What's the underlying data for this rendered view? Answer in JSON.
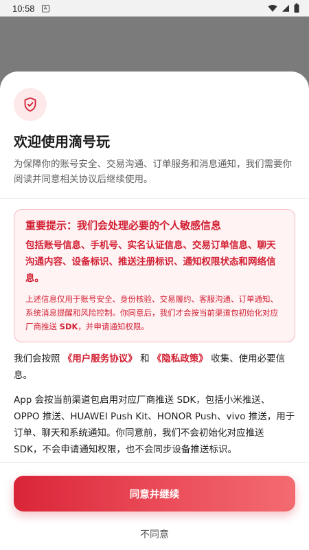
{
  "status_bar": {
    "time": "10:58",
    "notification_icon": "a-badge-icon",
    "icons": [
      "wifi-icon",
      "signal-icon",
      "battery-icon"
    ]
  },
  "dialog": {
    "icon": "shield-check-icon",
    "title": "欢迎使用滴号玩",
    "subtitle": "为保障你的账号安全、交易沟通、订单服务和消息通知，我们需要你阅读并同意相关协议后继续使用。",
    "notice": {
      "title": "重要提示：我们会处理必要的个人敏感信息",
      "bold_text": "包括账号信息、手机号、实名认证信息、交易订单信息、聊天沟通内容、设备标识、推送注册标识、通知权限状态和网络信息。",
      "small_prefix": "上述信息仅用于账号安全、身份核验、交易履约、客服沟通、订单通知、系统消息提醒和风险控制。你同意后，我们才会按当前渠道包初始化对应厂商推送 ",
      "small_bold": "SDK",
      "small_suffix": "，并申请通知权限。"
    },
    "agreement": {
      "prefix": "我们会按照 ",
      "link_terms": "《用户服务协议》",
      "middle": " 和 ",
      "link_privacy": "《隐私政策》",
      "suffix": " 收集、使用必要信息。"
    },
    "push_info": "App 会按当前渠道包启用对应厂商推送 SDK，包括小米推送、OPPO 推送、HUAWEI Push Kit、HONOR Push、vivo 推送，用于订单、聊天和系统通知。你同意前，我们不会初始化对应推送 SDK，不会申请通知权限，也不会同步设备推送标识。",
    "agree_label": "同意并继续",
    "decline_label": "不同意"
  },
  "colors": {
    "accent": "#d21f32",
    "notice_bg": "#fff3f4",
    "notice_border": "#f3b9bf",
    "button_gradient_start": "#d92538",
    "button_gradient_end": "#f36b70"
  }
}
